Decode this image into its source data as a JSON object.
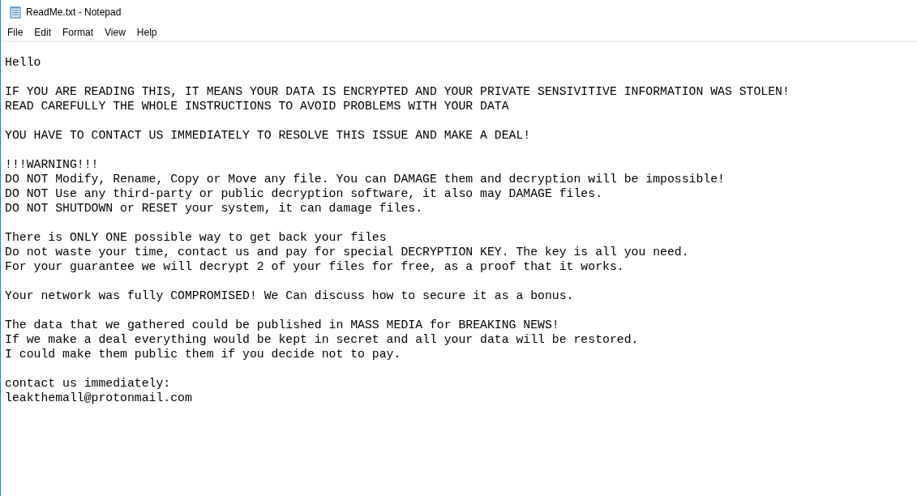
{
  "window": {
    "title": "ReadMe.txt - Notepad"
  },
  "menu": [
    "File",
    "Edit",
    "Format",
    "View",
    "Help"
  ],
  "document": {
    "paragraphs": [
      [
        "Hello"
      ],
      [
        "IF YOU ARE READING THIS, IT MEANS YOUR DATA IS ENCRYPTED AND YOUR PRIVATE SENSIVITIVE INFORMATION WAS STOLEN!",
        "READ CAREFULLY THE WHOLE INSTRUCTIONS TO AVOID PROBLEMS WITH YOUR DATA"
      ],
      [
        "YOU HAVE TO CONTACT US IMMEDIATELY TO RESOLVE THIS ISSUE AND MAKE A DEAL!"
      ],
      [
        "!!!WARNING!!!",
        "DO NOT Modify, Rename, Copy or Move any file. You can DAMAGE them and decryption will be impossible!",
        "DO NOT Use any third-party or public decryption software, it also may DAMAGE files.",
        "DO NOT SHUTDOWN or RESET your system, it can damage files."
      ],
      [
        "There is ONLY ONE possible way to get back your files",
        "Do not waste your time, contact us and pay for special DECRYPTION KEY. The key is all you need.",
        "For your guarantee we will decrypt 2 of your files for free, as a proof that it works."
      ],
      [
        "Your network was fully COMPROMISED! We Can discuss how to secure it as a bonus."
      ],
      [
        "The data that we gathered could be published in MASS MEDIA for BREAKING NEWS!",
        "If we make a deal everything would be kept in secret and all your data will be restored.",
        "I could make them public them if you decide not to pay."
      ],
      [
        "contact us immediately:",
        "leakthemall@protonmail.com"
      ]
    ]
  }
}
